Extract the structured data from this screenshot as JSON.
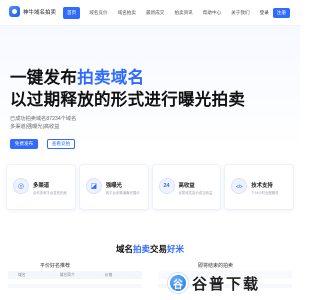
{
  "nav": {
    "logo_text": "神牛域名拍卖",
    "items": [
      "首页",
      "域名竞价",
      "域名拍卖",
      "最新成交",
      "拍卖资讯",
      "帮助中心",
      "关于我们"
    ],
    "active_index": 0,
    "login": "登录",
    "register": "注册"
  },
  "hero": {
    "headline_part1": "一键发布",
    "headline_highlight": "拍卖域名",
    "headline_line2": "以过期释放的形式进行曝光拍卖",
    "sub_line1": "已成功拍卖域名87234个域名",
    "sub_line2": "多渠道|强曝光|高收益",
    "primary_button": "免费发布",
    "secondary_button": "查看竞拍"
  },
  "features": [
    {
      "title": "多渠道",
      "desc": "合作多家平台发布拍卖",
      "icon": "broadcast-icon",
      "glyph": "◎"
    },
    {
      "title": "强曝光",
      "desc": "各平台多渠道曝光展示",
      "icon": "tag-icon",
      "glyph": "◪"
    },
    {
      "title": "高收益",
      "desc": "优质域名高价成交收益",
      "icon": "clock-24-icon",
      "glyph": "24"
    },
    {
      "title": "技术支持",
      "desc": "7*24小时全程服务",
      "icon": "code-icon",
      "glyph": "</>"
    }
  ],
  "section": {
    "title_part1": "域名",
    "title_highlight": "拍卖",
    "title_part2": "交易",
    "title_highlight2": "好米",
    "left_column_title": "平价好名推荐",
    "right_column_title": "即将结束的拍卖",
    "table_headers": [
      "域名",
      "域名简介",
      "价格"
    ]
  },
  "watermark": {
    "badge": "谷",
    "text": "谷普下载"
  },
  "colors": {
    "accent": "#2f6bff",
    "text": "#1f2329"
  }
}
